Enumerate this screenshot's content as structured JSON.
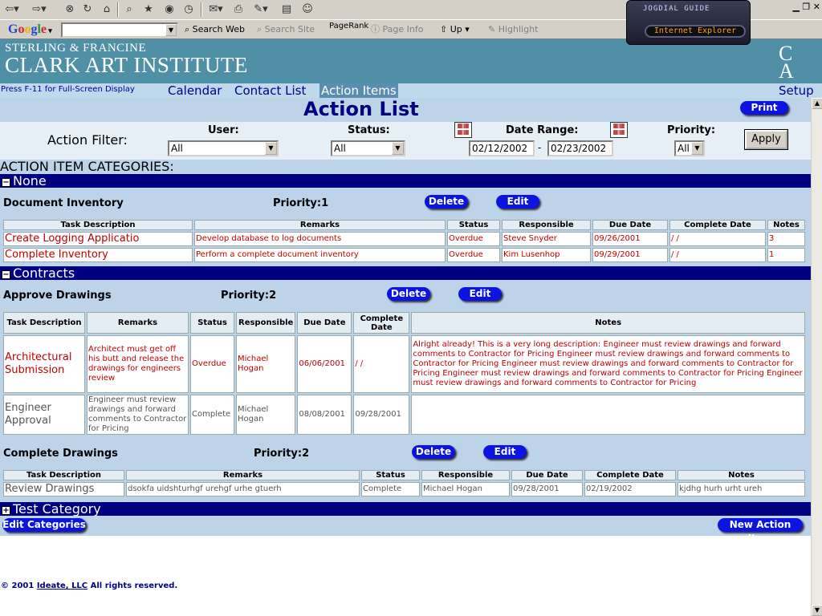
{
  "browser": {
    "google_label": "Google",
    "search_web": "Search Web",
    "search_site": "Search Site",
    "pagerank": "PageRank",
    "page_info": "Page Info",
    "up": "Up",
    "highlight": "Highlight",
    "jogdial_title": "JOGDIAL GUIDE",
    "jogdial_value": "Internet Explorer"
  },
  "header": {
    "subtitle": "STERLING & FRANCINE",
    "title": "CLARK ART INSTITUTE",
    "logo_top": "C",
    "logo_bottom": "A",
    "fullscreen_hint": "Press F-11 for Full-Screen Display"
  },
  "nav": {
    "calendar": "Calendar",
    "contact_list": "Contact List",
    "action_items": "Action Items",
    "setup": "Setup"
  },
  "page": {
    "title": "Action List",
    "print": "Print"
  },
  "filter": {
    "label": "Action Filter:",
    "user_label": "User:",
    "user_value": "All",
    "status_label": "Status:",
    "status_value": "All",
    "date_label": "Date Range:",
    "date_from": "02/12/2002",
    "date_sep": "-",
    "date_to": "02/23/2002",
    "priority_label": "Priority:",
    "priority_value": "All",
    "apply": "Apply"
  },
  "categories_label": "ACTION ITEM CATEGORIES:",
  "buttons": {
    "delete": "Delete",
    "edit": "Edit",
    "edit_categories": "Edit Categories",
    "new_action_item": "New Action Item"
  },
  "categories": [
    {
      "name": "None",
      "toggle": "−",
      "groups": [
        {
          "name": "Document Inventory",
          "priority": "Priority:1",
          "headers": [
            "Task Description",
            "Remarks",
            "Status",
            "Responsible",
            "Due Date",
            "Complete Date",
            "Notes"
          ],
          "rows": [
            [
              "Create Logging Applicatio",
              "Develop database to log documents",
              "Overdue",
              "Steve Snyder",
              "09/26/2001",
              "/ /",
              "3"
            ],
            [
              "Complete Inventory",
              "Perform a complete document inventory",
              "Overdue",
              "Kim Lusenhop",
              "09/29/2001",
              "/ /",
              "1"
            ]
          ]
        }
      ]
    },
    {
      "name": "Contracts",
      "toggle": "−",
      "groups": [
        {
          "name": "Approve Drawings",
          "priority": "Priority:2",
          "headers": [
            "Task Description",
            "Remarks",
            "Status",
            "Responsible",
            "Due Date",
            "Complete Date",
            "Notes"
          ],
          "rows": [
            [
              "Architectural Submission",
              "Architect must get off his butt and release the drawings for engineers review",
              "Overdue",
              "Michael Hogan",
              "06/06/2001",
              "/ /",
              "Alright already! This is a very long description: Engineer must review drawings and forward comments to Contractor for Pricing Engineer must review drawings and forward comments to Contractor for Pricing Engineer must review drawings and forward comments to Contractor for Pricing Engineer must review drawings and forward comments to Contractor for Pricing Engineer must review drawings and forward comments to Contractor for Pricing"
            ],
            [
              "Engineer Approval",
              "Engineer must review drawings and forward comments to Contractor for Pricing",
              "Complete",
              "Michael Hogan",
              "08/08/2001",
              "09/28/2001",
              ""
            ]
          ]
        },
        {
          "name": "Complete Drawings",
          "priority": "Priority:2",
          "headers": [
            "Task Description",
            "Remarks",
            "Status",
            "Responsible",
            "Due Date",
            "Complete Date",
            "Notes"
          ],
          "rows": [
            [
              "Review Drawings",
              "dsokfa uidshturhgf urehgf urhe gtuerh",
              "Complete",
              "Michael Hogan",
              "09/28/2001",
              "02/19/2002",
              "kjdhg hurh urht ureh"
            ]
          ]
        }
      ]
    },
    {
      "name": "Test Category",
      "toggle": "+"
    }
  ],
  "footer": {
    "copyright": "© 2001",
    "company": "Ideate, LLC",
    "rights": "All rights reserved."
  }
}
